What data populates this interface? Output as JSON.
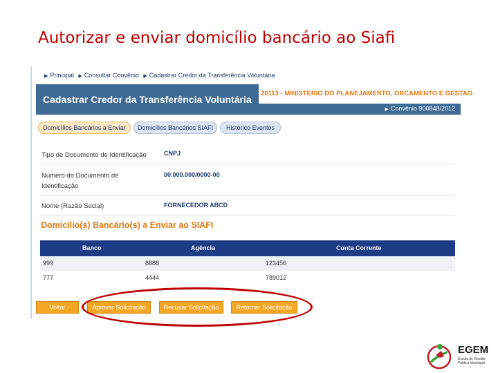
{
  "slide": {
    "title": "Autorizar e enviar domicílio bancário ao Siafi"
  },
  "breadcrumb": [
    "Principal",
    "Consultar Convênio",
    "Cadastrar Credor da Transferência Voluntária"
  ],
  "header": {
    "title": "Cadastrar Credor da Transferência Voluntária",
    "organization": "20113 - MINISTERIO DO PLANEJAMENTO, ORCAMENTO E GESTAO",
    "convenio": "Convênio 900848/2012"
  },
  "tabs": [
    {
      "label": "Domicílios Bancários a Enviar",
      "active": true
    },
    {
      "label": "Domicílios Bancários SIAFI",
      "active": false
    },
    {
      "label": "Histórico Eventos",
      "active": false
    }
  ],
  "fields": [
    {
      "label": "Tipo de Documento de Identificação",
      "value": "CNPJ"
    },
    {
      "label": "Número do Documento de Identificação",
      "value": "00.000.000/0000-00"
    },
    {
      "label": "Nome (Razão Social)",
      "value": "FORNECEDOR ABCD"
    }
  ],
  "section_title": "Domicílio(s) Bancário(s) a Enviar ao SIAFI",
  "table": {
    "columns": [
      "Banco",
      "Agência",
      "Conta Corrente"
    ],
    "rows": [
      [
        "999",
        "8888",
        "123456"
      ],
      [
        "777",
        "4444",
        "789012"
      ]
    ]
  },
  "buttons": {
    "voltar": "Voltar",
    "aprovar": "Aprovar Solicitação",
    "recusar": "Recusar Solicitação",
    "retornar": "Retornar Solicitação"
  },
  "logo": {
    "name": "EGEM",
    "subtitle_lines": [
      "Escola de Gestão",
      "Pública Municipal"
    ]
  },
  "colors": {
    "title_red": "#c00000",
    "header_blue": "#3e6a96",
    "table_header": "#1d3c86",
    "accent_orange": "#e07a14",
    "button_orange": "#f5a623"
  }
}
